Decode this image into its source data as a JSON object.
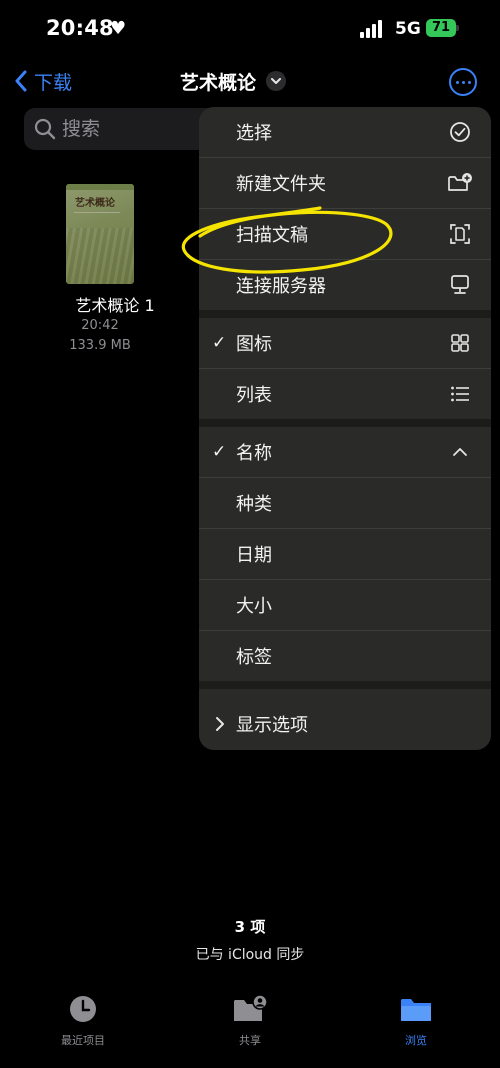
{
  "status_bar": {
    "time": "20:48",
    "network": "5G",
    "battery": "71"
  },
  "nav": {
    "back_label": "下载",
    "title": "艺术概论"
  },
  "search": {
    "placeholder": "搜索"
  },
  "file": {
    "name": "艺术概论 1",
    "time": "20:42",
    "size": "133.9 MB",
    "cover_title": "艺术概论"
  },
  "menu": {
    "items": [
      {
        "label": "选择",
        "icon": "checkmark-circle-icon",
        "checked": false
      },
      {
        "label": "新建文件夹",
        "icon": "folder-add-icon",
        "checked": false
      },
      {
        "label": "扫描文稿",
        "icon": "scan-document-icon",
        "checked": false
      },
      {
        "label": "连接服务器",
        "icon": "monitor-icon",
        "checked": false
      },
      {
        "label": "图标",
        "icon": "grid-icon",
        "checked": true
      },
      {
        "label": "列表",
        "icon": "list-icon",
        "checked": false
      },
      {
        "label": "名称",
        "icon": "chevron-up-icon",
        "checked": true
      },
      {
        "label": "种类",
        "icon": "",
        "checked": false
      },
      {
        "label": "日期",
        "icon": "",
        "checked": false
      },
      {
        "label": "大小",
        "icon": "",
        "checked": false
      },
      {
        "label": "标签",
        "icon": "",
        "checked": false
      },
      {
        "label": "显示选项",
        "icon": "",
        "checked": false
      }
    ]
  },
  "footer": {
    "count": "3 项",
    "sync_status": "已与 iCloud 同步"
  },
  "tabs": [
    {
      "label": "最近项目",
      "icon": "clock-icon",
      "active": false
    },
    {
      "label": "共享",
      "icon": "shared-folder-icon",
      "active": false
    },
    {
      "label": "浏览",
      "icon": "folder-icon",
      "active": true
    }
  ],
  "colors": {
    "accent": "#3b82f6",
    "menu_bg": "#2a2a28",
    "highlight": "#f5e400",
    "battery": "#34c759"
  }
}
